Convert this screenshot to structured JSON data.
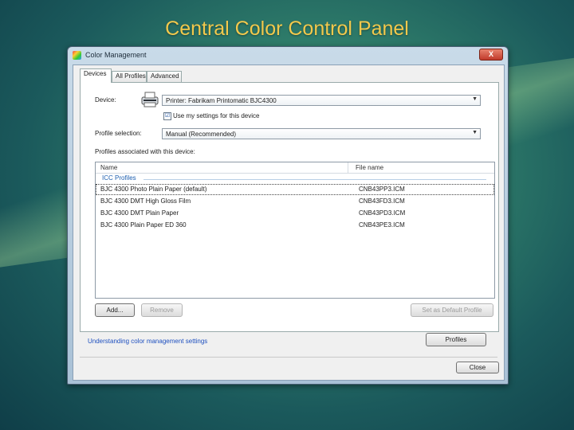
{
  "slide": {
    "title": "Central Color Control Panel"
  },
  "window": {
    "title": "Color Management",
    "close_glyph": "X"
  },
  "tabs": [
    {
      "label": "Devices",
      "active": true
    },
    {
      "label": "All Profiles",
      "active": false
    },
    {
      "label": "Advanced",
      "active": false
    }
  ],
  "device": {
    "label": "Device:",
    "selected": "Printer: Fabrikam Printomatic BJC4300",
    "icon": "printer-icon"
  },
  "use_my_settings": {
    "label": "Use my settings for this device",
    "checked": true,
    "glyph": "☑"
  },
  "profile_selection": {
    "label": "Profile selection:",
    "selected": "Manual (Recommended)"
  },
  "profiles_caption": "Profiles associated with this device:",
  "list": {
    "columns": [
      "Name",
      "File name"
    ],
    "group": "ICC Profiles",
    "rows": [
      {
        "name": "BJC 4300 Photo Plain Paper (default)",
        "file": "CNB43PP3.ICM"
      },
      {
        "name": "BJC 4300 DMT High Gloss Film",
        "file": "CNB43FD3.ICM"
      },
      {
        "name": "BJC 4300 DMT Plain Paper",
        "file": "CNB43PD3.ICM"
      },
      {
        "name": "BJC 4300 Plain Paper ED 360",
        "file": "CNB43PE3.ICM"
      }
    ]
  },
  "buttons": {
    "add": "Add...",
    "remove": "Remove",
    "set_default": "Set as Default Profile",
    "profiles": "Profiles",
    "close": "Close"
  },
  "help_link": "Understanding color management settings",
  "colors": {
    "title": "#f2c94c",
    "link": "#1d4fbf",
    "group": "#1d5fb0"
  }
}
